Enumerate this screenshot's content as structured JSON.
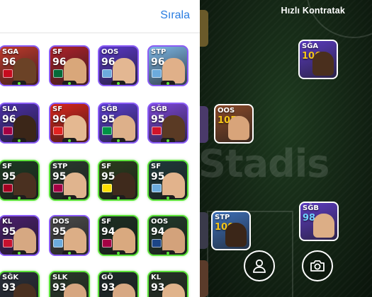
{
  "panel": {
    "sort_label": "Sırala"
  },
  "players": [
    {
      "pos": "SGA",
      "rating": "96",
      "style": "purple",
      "bg": "#c0392b",
      "skin": "#6b4226",
      "flag": "#c60b1e"
    },
    {
      "pos": "SF",
      "rating": "96",
      "style": "purple",
      "bg": "#b0222b",
      "skin": "#d9a77a",
      "flag": "#046a38"
    },
    {
      "pos": "OOS",
      "rating": "96",
      "style": "purple",
      "bg": "#5a38c9",
      "skin": "#e3b792",
      "flag": "#6cabdd"
    },
    {
      "pos": "STP",
      "rating": "96",
      "style": "purple",
      "bg": "#7db7e6",
      "skin": "#e0b089",
      "flag": "#6cabdd"
    },
    {
      "pos": "SLA",
      "rating": "96",
      "style": "purple",
      "bg": "#4b2fa8",
      "skin": "#3b2618",
      "flag": "#a50044"
    },
    {
      "pos": "SF",
      "rating": "96",
      "style": "purple",
      "bg": "#d9261c",
      "skin": "#e4b891",
      "flag": "#e32221"
    },
    {
      "pos": "SĞB",
      "rating": "95",
      "style": "purple",
      "bg": "#5c3ed1",
      "skin": "#ddb08a",
      "flag": "#009246"
    },
    {
      "pos": "SĞB",
      "rating": "95",
      "style": "purple",
      "bg": "#7b46d8",
      "skin": "#5a3a24",
      "flag": "#cf142b"
    },
    {
      "pos": "SF",
      "rating": "95",
      "style": "green",
      "bg": "#1d3a22",
      "skin": "#4a3020",
      "flag": "#a50021"
    },
    {
      "pos": "STP",
      "rating": "95",
      "style": "green",
      "bg": "#2a3a2e",
      "skin": "#e0b48e",
      "flag": "#a50044"
    },
    {
      "pos": "SF",
      "rating": "95",
      "style": "green",
      "bg": "#2b3d1c",
      "skin": "#3f2a1c",
      "flag": "#fde100"
    },
    {
      "pos": "SF",
      "rating": "95",
      "style": "green",
      "bg": "#1f3a3a",
      "skin": "#e2b38c",
      "flag": "#6cabdd"
    },
    {
      "pos": "KL",
      "rating": "95",
      "style": "purple",
      "bg": "#4a1e6e",
      "skin": "#d6a882",
      "flag": "#c8102e"
    },
    {
      "pos": "DOS",
      "rating": "95",
      "style": "purple",
      "bg": "#4b4b4b",
      "skin": "#dcae86",
      "flag": "#6cabdd"
    },
    {
      "pos": "SF",
      "rating": "94",
      "style": "green",
      "bg": "#1c2f22",
      "skin": "#d9a97f",
      "flag": "#a50044"
    },
    {
      "pos": "OOS",
      "rating": "94",
      "style": "green",
      "bg": "#223a2a",
      "skin": "#d3a27b",
      "flag": "#1c4587"
    },
    {
      "pos": "SĞK",
      "rating": "93",
      "style": "green",
      "bg": "#2a2f3a",
      "skin": "#4a3020",
      "flag": "#003366"
    },
    {
      "pos": "SLK",
      "rating": "93",
      "style": "green",
      "bg": "#2a3a2a",
      "skin": "#d6a680",
      "flag": "#006847"
    },
    {
      "pos": "GÖ",
      "rating": "93",
      "style": "green",
      "bg": "#1e2a2a",
      "skin": "#d7a883",
      "flag": "#1a4a8a"
    },
    {
      "pos": "KL",
      "rating": "93",
      "style": "green",
      "bg": "#263326",
      "skin": "#e0b38b",
      "flag": "#6cabdd"
    }
  ],
  "pitch": {
    "title": "Hızlı Kontratak",
    "watermark": "Stadis",
    "cards": [
      {
        "pos": "SĞA",
        "rating": "106",
        "rating_color": "#f5c518",
        "bg": "#5a3bbf",
        "skin": "#4a2f1d"
      },
      {
        "pos": "OOS",
        "rating": "105",
        "rating_color": "#f5c518",
        "bg": "#8a4a2a",
        "skin": "#d8a47a"
      },
      {
        "pos": "STP",
        "rating": "100",
        "rating_color": "#f5c518",
        "bg": "#3d6fb8",
        "skin": "#3b2618"
      },
      {
        "pos": "SĞB",
        "rating": "98",
        "rating_color": "#6fd0ff",
        "bg": "#5d3cc2",
        "skin": "#dcae86"
      }
    ],
    "profile_icon": "person-icon",
    "camera_icon": "camera-icon"
  }
}
